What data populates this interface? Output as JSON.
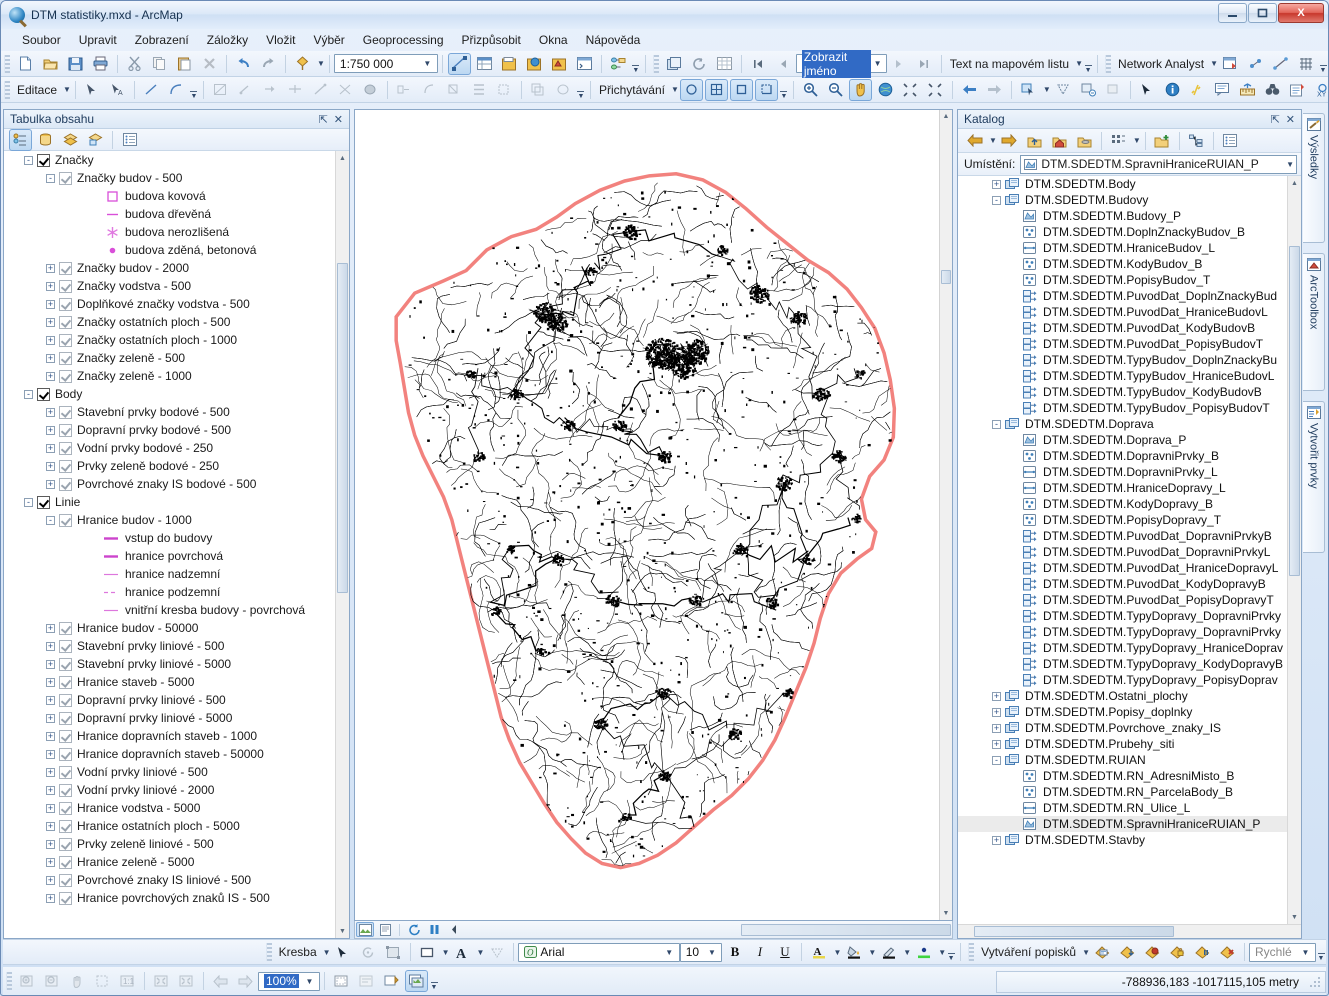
{
  "window": {
    "title": "DTM statistiky.mxd - ArcMap",
    "app_icon": "arcmap-globe-icon",
    "minimize_label": "—",
    "maximize_label": "❐",
    "close_label": "X"
  },
  "menu": {
    "items": [
      {
        "label": "Soubor",
        "name": "menu-soubor"
      },
      {
        "label": "Upravit",
        "name": "menu-upravit"
      },
      {
        "label": "Zobrazení",
        "name": "menu-zobrazeni"
      },
      {
        "label": "Záložky",
        "name": "menu-zalozky"
      },
      {
        "label": "Vložit",
        "name": "menu-vlozit"
      },
      {
        "label": "Výběr",
        "name": "menu-vyber"
      },
      {
        "label": "Geoprocessing",
        "name": "menu-geoprocessing"
      },
      {
        "label": "Přizpůsobit",
        "name": "menu-prizpusobit"
      },
      {
        "label": "Okna",
        "name": "menu-okna"
      },
      {
        "label": "Nápověda",
        "name": "menu-napoveda"
      }
    ]
  },
  "standard_toolbar": {
    "scale_value": "1:750 000",
    "find_value": "Zobrazit jméno",
    "text_tool_label": "Text na mapovém listu",
    "network_analyst_label": "Network Analyst"
  },
  "editor_toolbar": {
    "editor_label": "Editace",
    "snapping_label": "Přichytávání"
  },
  "toc": {
    "title": "Tabulka obsahu",
    "pin_label": "⇱",
    "close_label": "✕",
    "rows": [
      {
        "indent": 1,
        "exp": "-",
        "chk": "on-dark",
        "label": "Značky"
      },
      {
        "indent": 2,
        "exp": "-",
        "chk": "on-grey",
        "label": "Značky budov - 500"
      },
      {
        "indent": 4,
        "exp": "",
        "chk": "",
        "sym": "square-outline",
        "color": "#d94fd9",
        "label": "budova kovová"
      },
      {
        "indent": 4,
        "exp": "",
        "chk": "",
        "sym": "dash",
        "color": "#d94fd9",
        "label": "budova dřevěná"
      },
      {
        "indent": 4,
        "exp": "",
        "chk": "",
        "sym": "asterisk",
        "color": "#e07ae0",
        "label": "budova nerozlišená"
      },
      {
        "indent": 4,
        "exp": "",
        "chk": "",
        "sym": "dot",
        "color": "#d94fd9",
        "label": "budova zděná, betonová"
      },
      {
        "indent": 2,
        "exp": "+",
        "chk": "on-grey",
        "label": "Značky budov - 2000"
      },
      {
        "indent": 2,
        "exp": "+",
        "chk": "on-grey",
        "label": "Značky vodstva - 500"
      },
      {
        "indent": 2,
        "exp": "+",
        "chk": "on-grey",
        "label": "Doplňkové značky vodstva - 500"
      },
      {
        "indent": 2,
        "exp": "+",
        "chk": "on-grey",
        "label": "Značky ostatních ploch - 500"
      },
      {
        "indent": 2,
        "exp": "+",
        "chk": "on-grey",
        "label": "Značky ostatních ploch - 1000"
      },
      {
        "indent": 2,
        "exp": "+",
        "chk": "on-grey",
        "label": "Značky zeleně - 500"
      },
      {
        "indent": 2,
        "exp": "+",
        "chk": "on-grey",
        "label": "Značky zeleně - 1000"
      },
      {
        "indent": 1,
        "exp": "-",
        "chk": "on-dark",
        "label": "Body"
      },
      {
        "indent": 2,
        "exp": "+",
        "chk": "on-grey",
        "label": "Stavební prvky bodové - 500"
      },
      {
        "indent": 2,
        "exp": "+",
        "chk": "on-grey",
        "label": "Dopravní prvky bodové - 500"
      },
      {
        "indent": 2,
        "exp": "+",
        "chk": "on-grey",
        "label": "Vodní prvky bodové - 250"
      },
      {
        "indent": 2,
        "exp": "+",
        "chk": "on-grey",
        "label": "Prvky zeleně bodové - 250"
      },
      {
        "indent": 2,
        "exp": "+",
        "chk": "on-grey",
        "label": "Povrchové znaky IS bodové - 500"
      },
      {
        "indent": 1,
        "exp": "-",
        "chk": "on-dark",
        "label": "Linie"
      },
      {
        "indent": 2,
        "exp": "-",
        "chk": "on-grey",
        "label": "Hranice budov - 1000"
      },
      {
        "indent": 4,
        "exp": "",
        "chk": "",
        "sym": "line-thick",
        "color": "#cc44cc",
        "label": "vstup do budovy"
      },
      {
        "indent": 4,
        "exp": "",
        "chk": "",
        "sym": "line-thick",
        "color": "#cc44cc",
        "label": "hranice povrchová"
      },
      {
        "indent": 4,
        "exp": "",
        "chk": "",
        "sym": "line-thin",
        "color": "#dd77dd",
        "label": "hranice nadzemní"
      },
      {
        "indent": 4,
        "exp": "",
        "chk": "",
        "sym": "line-dash",
        "color": "#dd77dd",
        "label": "hranice podzemní"
      },
      {
        "indent": 4,
        "exp": "",
        "chk": "",
        "sym": "line-thin",
        "color": "#dd77dd",
        "label": "vnitřní kresba budovy - povrchová"
      },
      {
        "indent": 2,
        "exp": "+",
        "chk": "on-grey",
        "label": "Hranice budov - 50000"
      },
      {
        "indent": 2,
        "exp": "+",
        "chk": "on-grey",
        "label": "Stavební prvky liniové - 500"
      },
      {
        "indent": 2,
        "exp": "+",
        "chk": "on-grey",
        "label": "Stavební prvky liniové - 5000"
      },
      {
        "indent": 2,
        "exp": "+",
        "chk": "on-grey",
        "label": "Hranice staveb - 5000"
      },
      {
        "indent": 2,
        "exp": "+",
        "chk": "on-grey",
        "label": "Dopravní prvky liniové - 500"
      },
      {
        "indent": 2,
        "exp": "+",
        "chk": "on-grey",
        "label": "Dopravní prvky liniové - 5000"
      },
      {
        "indent": 2,
        "exp": "+",
        "chk": "on-grey",
        "label": "Hranice dopravních staveb - 1000"
      },
      {
        "indent": 2,
        "exp": "+",
        "chk": "on-grey",
        "label": "Hranice dopravních staveb - 50000"
      },
      {
        "indent": 2,
        "exp": "+",
        "chk": "on-grey",
        "label": "Vodní prvky liniové - 500"
      },
      {
        "indent": 2,
        "exp": "+",
        "chk": "on-grey",
        "label": "Vodní prvky liniové - 2000"
      },
      {
        "indent": 2,
        "exp": "+",
        "chk": "on-grey",
        "label": "Hranice vodstva - 5000"
      },
      {
        "indent": 2,
        "exp": "+",
        "chk": "on-grey",
        "label": "Hranice ostatních ploch - 5000"
      },
      {
        "indent": 2,
        "exp": "+",
        "chk": "on-grey",
        "label": "Prvky zeleně liniové - 500"
      },
      {
        "indent": 2,
        "exp": "+",
        "chk": "on-grey",
        "label": "Hranice zeleně - 5000"
      },
      {
        "indent": 2,
        "exp": "+",
        "chk": "on-grey",
        "label": "Povrchové znaky IS liniové - 500"
      },
      {
        "indent": 2,
        "exp": "+",
        "chk": "on-grey",
        "label": "Hranice povrchových znaků IS - 500"
      }
    ]
  },
  "catalog": {
    "title": "Katalog",
    "pin_label": "⇱",
    "close_label": "✕",
    "location_label": "Umístění:",
    "location_value": "DTM.SDEDTM.SpravniHraniceRUIAN_P",
    "rows": [
      {
        "indent": 1,
        "exp": "+",
        "icon": "dataset-icon",
        "label": "DTM.SDEDTM.Body"
      },
      {
        "indent": 1,
        "exp": "-",
        "icon": "dataset-icon",
        "label": "DTM.SDEDTM.Budovy"
      },
      {
        "indent": 2,
        "exp": "",
        "icon": "polygon-icon",
        "label": "DTM.SDEDTM.Budovy_P"
      },
      {
        "indent": 2,
        "exp": "",
        "icon": "point-icon",
        "label": "DTM.SDEDTM.DoplnZnackyBudov_B"
      },
      {
        "indent": 2,
        "exp": "",
        "icon": "line-icon",
        "label": "DTM.SDEDTM.HraniceBudov_L"
      },
      {
        "indent": 2,
        "exp": "",
        "icon": "point-icon",
        "label": "DTM.SDEDTM.KodyBudov_B"
      },
      {
        "indent": 2,
        "exp": "",
        "icon": "point-icon",
        "label": "DTM.SDEDTM.PopisyBudov_T"
      },
      {
        "indent": 2,
        "exp": "",
        "icon": "relationship-icon",
        "label": "DTM.SDEDTM.PuvodDat_DoplnZnackyBud"
      },
      {
        "indent": 2,
        "exp": "",
        "icon": "relationship-icon",
        "label": "DTM.SDEDTM.PuvodDat_HraniceBudovL"
      },
      {
        "indent": 2,
        "exp": "",
        "icon": "relationship-icon",
        "label": "DTM.SDEDTM.PuvodDat_KodyBudovB"
      },
      {
        "indent": 2,
        "exp": "",
        "icon": "relationship-icon",
        "label": "DTM.SDEDTM.PuvodDat_PopisyBudovT"
      },
      {
        "indent": 2,
        "exp": "",
        "icon": "relationship-icon",
        "label": "DTM.SDEDTM.TypyBudov_DoplnZnackyBu"
      },
      {
        "indent": 2,
        "exp": "",
        "icon": "relationship-icon",
        "label": "DTM.SDEDTM.TypyBudov_HraniceBudovL"
      },
      {
        "indent": 2,
        "exp": "",
        "icon": "relationship-icon",
        "label": "DTM.SDEDTM.TypyBudov_KodyBudovB"
      },
      {
        "indent": 2,
        "exp": "",
        "icon": "relationship-icon",
        "label": "DTM.SDEDTM.TypyBudov_PopisyBudovT"
      },
      {
        "indent": 1,
        "exp": "-",
        "icon": "dataset-icon",
        "label": "DTM.SDEDTM.Doprava"
      },
      {
        "indent": 2,
        "exp": "",
        "icon": "polygon-icon",
        "label": "DTM.SDEDTM.Doprava_P"
      },
      {
        "indent": 2,
        "exp": "",
        "icon": "point-icon",
        "label": "DTM.SDEDTM.DopravniPrvky_B"
      },
      {
        "indent": 2,
        "exp": "",
        "icon": "line-icon",
        "label": "DTM.SDEDTM.DopravniPrvky_L"
      },
      {
        "indent": 2,
        "exp": "",
        "icon": "line-icon",
        "label": "DTM.SDEDTM.HraniceDopravy_L"
      },
      {
        "indent": 2,
        "exp": "",
        "icon": "point-icon",
        "label": "DTM.SDEDTM.KodyDopravy_B"
      },
      {
        "indent": 2,
        "exp": "",
        "icon": "point-icon",
        "label": "DTM.SDEDTM.PopisyDopravy_T"
      },
      {
        "indent": 2,
        "exp": "",
        "icon": "relationship-icon",
        "label": "DTM.SDEDTM.PuvodDat_DopravniPrvkyB"
      },
      {
        "indent": 2,
        "exp": "",
        "icon": "relationship-icon",
        "label": "DTM.SDEDTM.PuvodDat_DopravniPrvkyL"
      },
      {
        "indent": 2,
        "exp": "",
        "icon": "relationship-icon",
        "label": "DTM.SDEDTM.PuvodDat_HraniceDopravyL"
      },
      {
        "indent": 2,
        "exp": "",
        "icon": "relationship-icon",
        "label": "DTM.SDEDTM.PuvodDat_KodyDopravyB"
      },
      {
        "indent": 2,
        "exp": "",
        "icon": "relationship-icon",
        "label": "DTM.SDEDTM.PuvodDat_PopisyDopravyT"
      },
      {
        "indent": 2,
        "exp": "",
        "icon": "relationship-icon",
        "label": "DTM.SDEDTM.TypyDopravy_DopravniPrvky"
      },
      {
        "indent": 2,
        "exp": "",
        "icon": "relationship-icon",
        "label": "DTM.SDEDTM.TypyDopravy_DopravniPrvky"
      },
      {
        "indent": 2,
        "exp": "",
        "icon": "relationship-icon",
        "label": "DTM.SDEDTM.TypyDopravy_HraniceDoprav"
      },
      {
        "indent": 2,
        "exp": "",
        "icon": "relationship-icon",
        "label": "DTM.SDEDTM.TypyDopravy_KodyDopravyB"
      },
      {
        "indent": 2,
        "exp": "",
        "icon": "relationship-icon",
        "label": "DTM.SDEDTM.TypyDopravy_PopisyDoprav"
      },
      {
        "indent": 1,
        "exp": "+",
        "icon": "dataset-icon",
        "label": "DTM.SDEDTM.Ostatni_plochy"
      },
      {
        "indent": 1,
        "exp": "+",
        "icon": "dataset-icon",
        "label": "DTM.SDEDTM.Popisy_doplnky"
      },
      {
        "indent": 1,
        "exp": "+",
        "icon": "dataset-icon",
        "label": "DTM.SDEDTM.Povrchove_znaky_IS"
      },
      {
        "indent": 1,
        "exp": "+",
        "icon": "dataset-icon",
        "label": "DTM.SDEDTM.Prubehy_siti"
      },
      {
        "indent": 1,
        "exp": "-",
        "icon": "dataset-icon",
        "label": "DTM.SDEDTM.RUIAN"
      },
      {
        "indent": 2,
        "exp": "",
        "icon": "point-icon",
        "label": "DTM.SDEDTM.RN_AdresniMisto_B"
      },
      {
        "indent": 2,
        "exp": "",
        "icon": "point-icon",
        "label": "DTM.SDEDTM.RN_ParcelaBody_B"
      },
      {
        "indent": 2,
        "exp": "",
        "icon": "line-icon",
        "label": "DTM.SDEDTM.RN_Ulice_L"
      },
      {
        "indent": 2,
        "exp": "",
        "icon": "polygon-icon",
        "label": "DTM.SDEDTM.SpravniHraniceRUIAN_P",
        "selected": true
      },
      {
        "indent": 1,
        "exp": "+",
        "icon": "dataset-icon",
        "label": "DTM.SDEDTM.Stavby"
      }
    ]
  },
  "side_tabs": [
    {
      "label": "Výsledky",
      "icon": "results-icon"
    },
    {
      "label": "ArcToolbox",
      "icon": "arctoolbox-icon"
    },
    {
      "label": "Vytvořit prvky",
      "icon": "create-features-icon"
    }
  ],
  "draw_toolbar": {
    "draw_label": "Kresba",
    "font_value": "Arial",
    "font_size_value": "10",
    "bold_label": "B",
    "italic_label": "I",
    "underline_label": "U",
    "labeling_label": "Vytváření popisků",
    "quick_label": "Rychlé"
  },
  "layout_toolbar": {
    "zoom_value": "100%"
  },
  "status_bar": {
    "coordinates": "-788936,183  -1017115,105 metry"
  },
  "map": {
    "boundary_color": "#f2827e",
    "feature_color": "#000000",
    "background_color": "#ffffff"
  }
}
